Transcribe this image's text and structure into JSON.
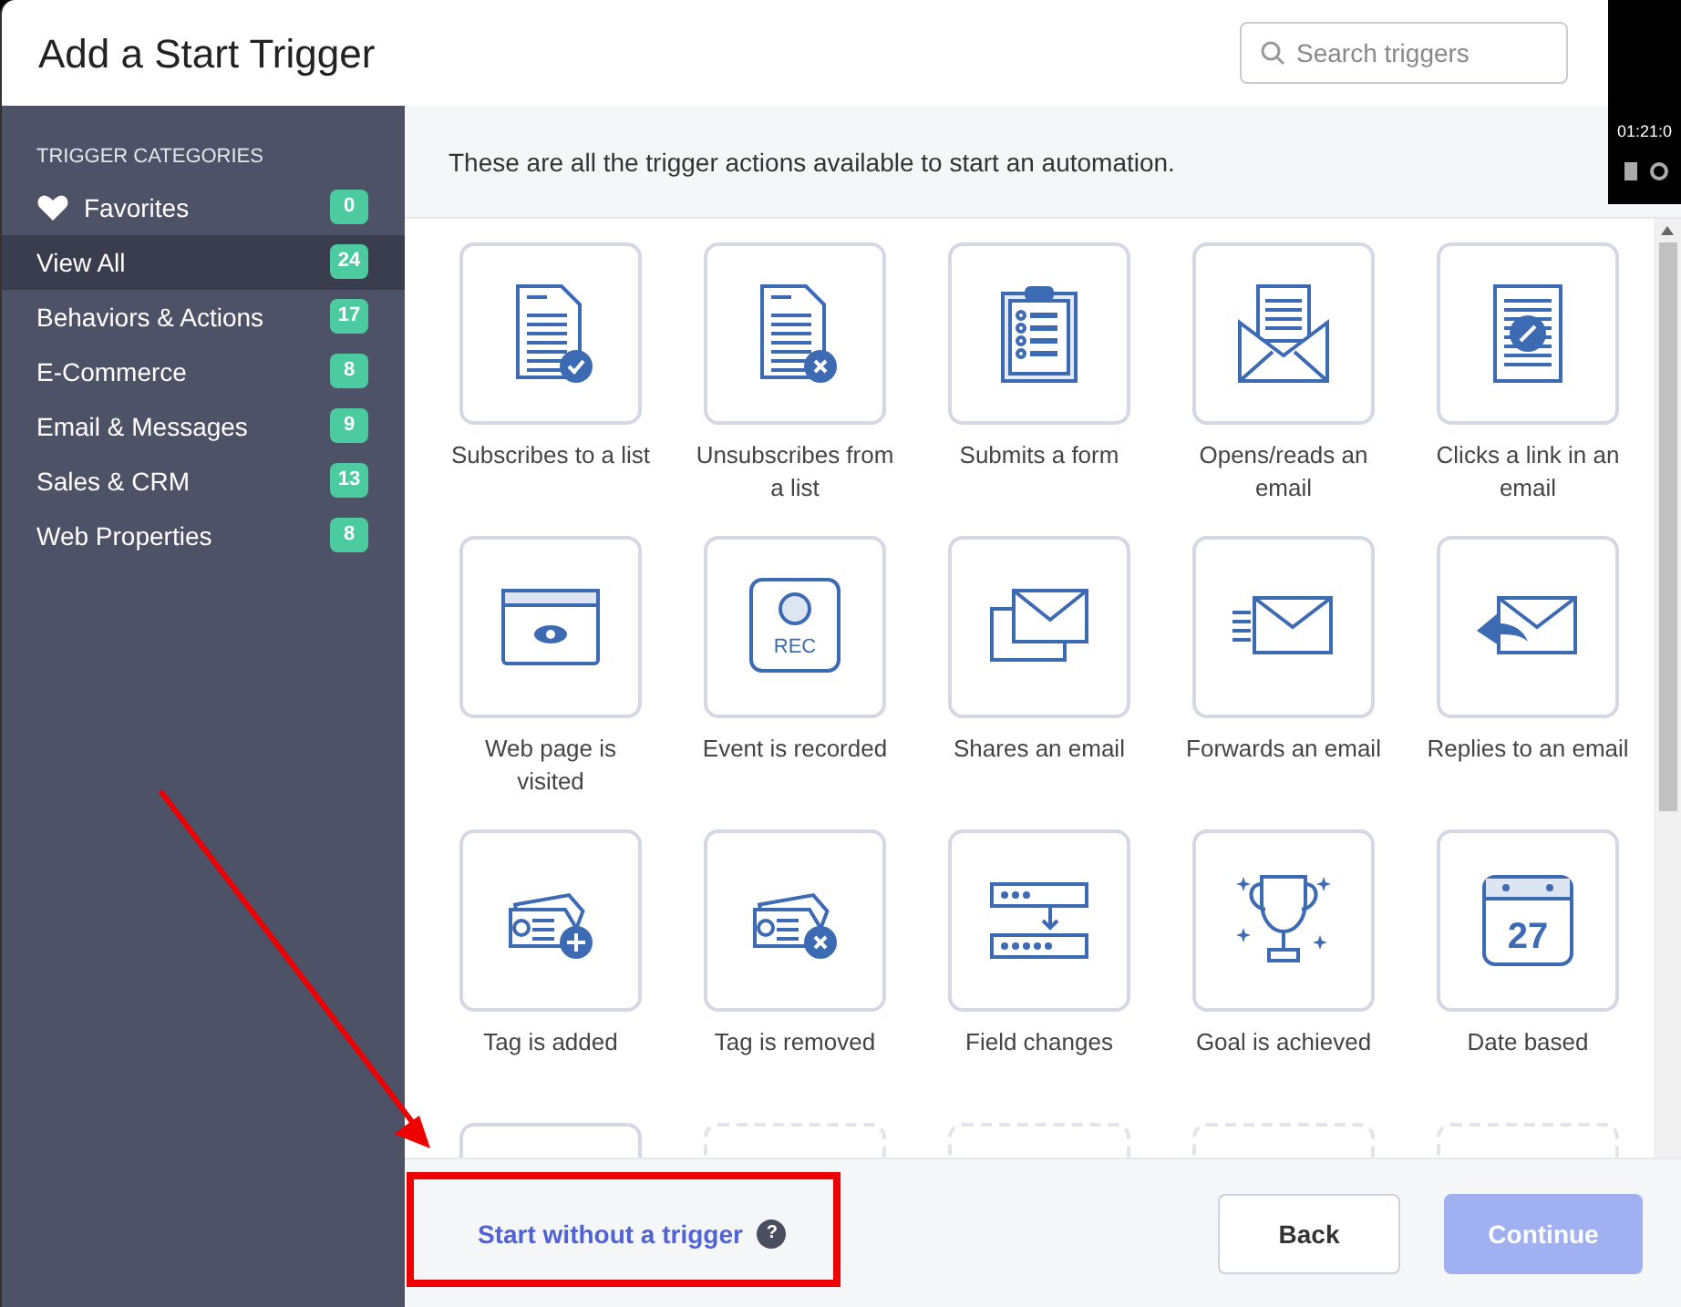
{
  "dialog": {
    "title": "Add a Start Trigger",
    "search": {
      "placeholder": "Search triggers"
    }
  },
  "sidebar": {
    "heading": "TRIGGER CATEGORIES",
    "items": [
      {
        "label": "Favorites",
        "count": "0",
        "selected": false,
        "kind": "favorites"
      },
      {
        "label": "View All",
        "count": "24",
        "selected": true
      },
      {
        "label": "Behaviors & Actions",
        "count": "17",
        "selected": false
      },
      {
        "label": "E-Commerce",
        "count": "8",
        "selected": false
      },
      {
        "label": "Email & Messages",
        "count": "9",
        "selected": false
      },
      {
        "label": "Sales & CRM",
        "count": "13",
        "selected": false
      },
      {
        "label": "Web Properties",
        "count": "8",
        "selected": false
      }
    ]
  },
  "intro": "These are all the trigger actions available to start an automation.",
  "triggers": [
    {
      "label": "Subscribes to a list"
    },
    {
      "label": "Unsubscribes from a list"
    },
    {
      "label": "Submits a form"
    },
    {
      "label": "Opens/reads an email"
    },
    {
      "label": "Clicks a link in an email"
    },
    {
      "label": "Web page is visited"
    },
    {
      "label": "Event is recorded",
      "icon_text": "REC"
    },
    {
      "label": "Shares an email"
    },
    {
      "label": "Forwards an email"
    },
    {
      "label": "Replies to an email"
    },
    {
      "label": "Tag is added"
    },
    {
      "label": "Tag is removed"
    },
    {
      "label": "Field changes"
    },
    {
      "label": "Goal is achieved"
    },
    {
      "label": "Date based",
      "icon_text": "27"
    }
  ],
  "partial_tiles": [
    {
      "kind": "solid"
    },
    {
      "kind": "dashed"
    },
    {
      "kind": "dashed"
    },
    {
      "kind": "dashed"
    },
    {
      "kind": "dashed"
    }
  ],
  "footer": {
    "link": "Start without a trigger",
    "help": "?",
    "back": "Back",
    "continue": {
      "label": "Continue",
      "disabled": true
    }
  },
  "background_player": {
    "time": "01:21:0"
  }
}
